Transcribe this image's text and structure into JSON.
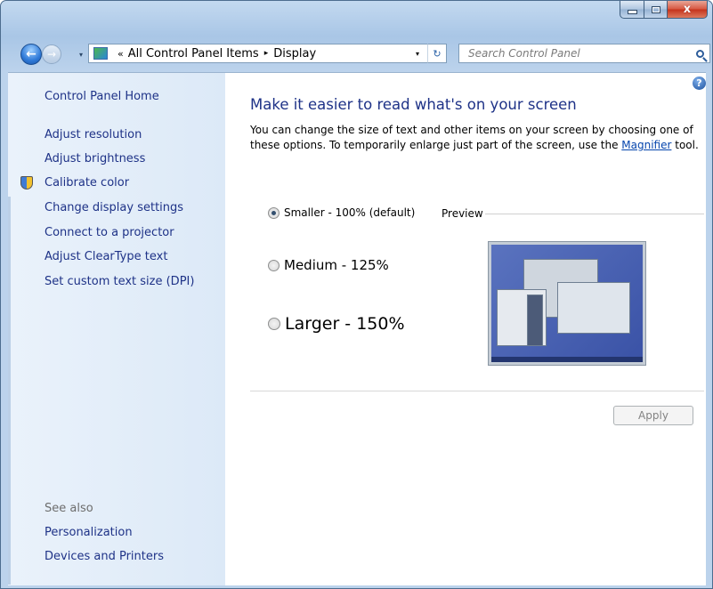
{
  "window": {
    "minimize_glyph": "",
    "close_glyph": "x"
  },
  "navbar": {
    "back_glyph": "←",
    "forward_glyph": "→",
    "breadcrumb_chevron": "«",
    "breadcrumb": [
      "All Control Panel Items",
      "Display"
    ],
    "breadcrumb_sep": "▸",
    "dropdown_glyph": "▾",
    "refresh_glyph": "↻",
    "search_placeholder": "Search Control Panel"
  },
  "sidebar": {
    "home": "Control Panel Home",
    "items": [
      "Adjust resolution",
      "Adjust brightness",
      "Calibrate color",
      "Change display settings",
      "Connect to a projector",
      "Adjust ClearType text",
      "Set custom text size (DPI)"
    ],
    "see_also_label": "See also",
    "see_also_items": [
      "Personalization",
      "Devices and Printers"
    ]
  },
  "main": {
    "help_glyph": "?",
    "title": "Make it easier to read what's on your screen",
    "description_before_link": "You can change the size of text and other items on your screen by choosing one of these options. To temporarily enlarge just part of the screen, use the ",
    "description_link": "Magnifier",
    "description_after_link": " tool.",
    "options": [
      {
        "label": "Smaller - 100% (default)",
        "selected": true
      },
      {
        "label": "Medium - 125%",
        "selected": false
      },
      {
        "label": "Larger - 150%",
        "selected": false
      }
    ],
    "preview_label": "Preview",
    "apply_label": "Apply"
  }
}
